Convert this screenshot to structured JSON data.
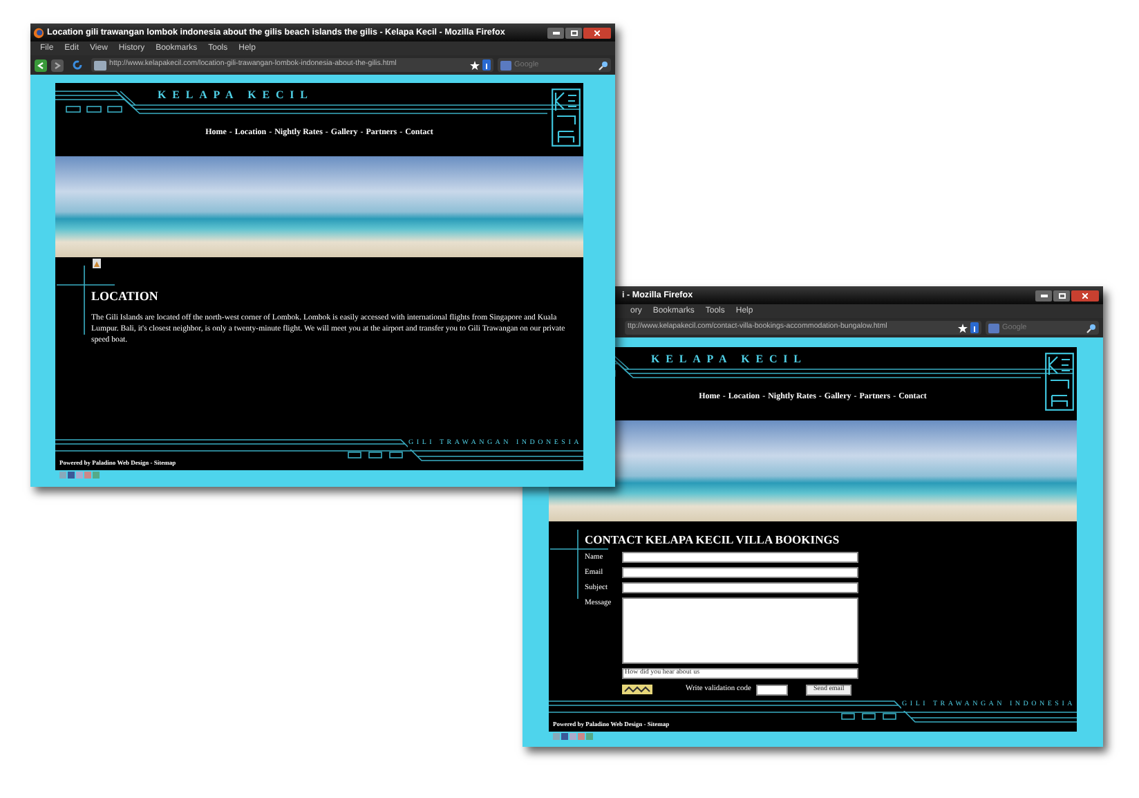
{
  "back_window": {
    "title": "i - Mozilla Firefox",
    "menu": [
      "ory",
      "Bookmarks",
      "Tools",
      "Help"
    ],
    "url": "ttp://www.kelapakecil.com/contact-villa-bookings-accommodation-bungalow.html",
    "search_placeholder": "Google",
    "page": {
      "brand": "KELAPA KECIL",
      "nav": [
        "Home",
        "Location",
        "Nightly Rates",
        "Gallery",
        "Partners",
        "Contact"
      ],
      "nav_separator": "-",
      "heading": "CONTACT KELAPA KECIL VILLA BOOKINGS",
      "form": {
        "fields": [
          {
            "label": "Name",
            "kind": "line"
          },
          {
            "label": "Email",
            "kind": "line"
          },
          {
            "label": "Subject",
            "kind": "line"
          },
          {
            "label": "Message",
            "kind": "area"
          }
        ],
        "source_select": "How did you hear about us",
        "validation_label": "Write validation code",
        "submit": "Send email"
      },
      "tagline": "GILI TRAWANGAN INDONESIA",
      "credit": "Powered by Paladino Web Design - Sitemap"
    }
  },
  "front_window": {
    "title": "Location gili trawangan lombok indonesia about the gilis beach islands the gilis - Kelapa Kecil - Mozilla Firefox",
    "menu": [
      "File",
      "Edit",
      "View",
      "History",
      "Bookmarks",
      "Tools",
      "Help"
    ],
    "url": "http://www.kelapakecil.com/location-gili-trawangan-lombok-indonesia-about-the-gilis.html",
    "search_placeholder": "Google",
    "page": {
      "brand": "KELAPA KECIL",
      "nav": [
        "Home",
        "Location",
        "Nightly Rates",
        "Gallery",
        "Partners",
        "Contact"
      ],
      "nav_separator": "-",
      "heading": "LOCATION",
      "body": "The Gili Islands are located off the north-west corner of Lombok. Lombok is easily accessed with international flights from Singapore and Kuala Lumpur. Bali, it's closest neighbor, is only a twenty-minute flight. We will meet you at the airport and transfer you to Gili Trawangan on our private speed boat.",
      "tagline": "GILI TRAWANGAN INDONESIA",
      "credit": "Powered by Paladino Web Design - Sitemap"
    }
  }
}
